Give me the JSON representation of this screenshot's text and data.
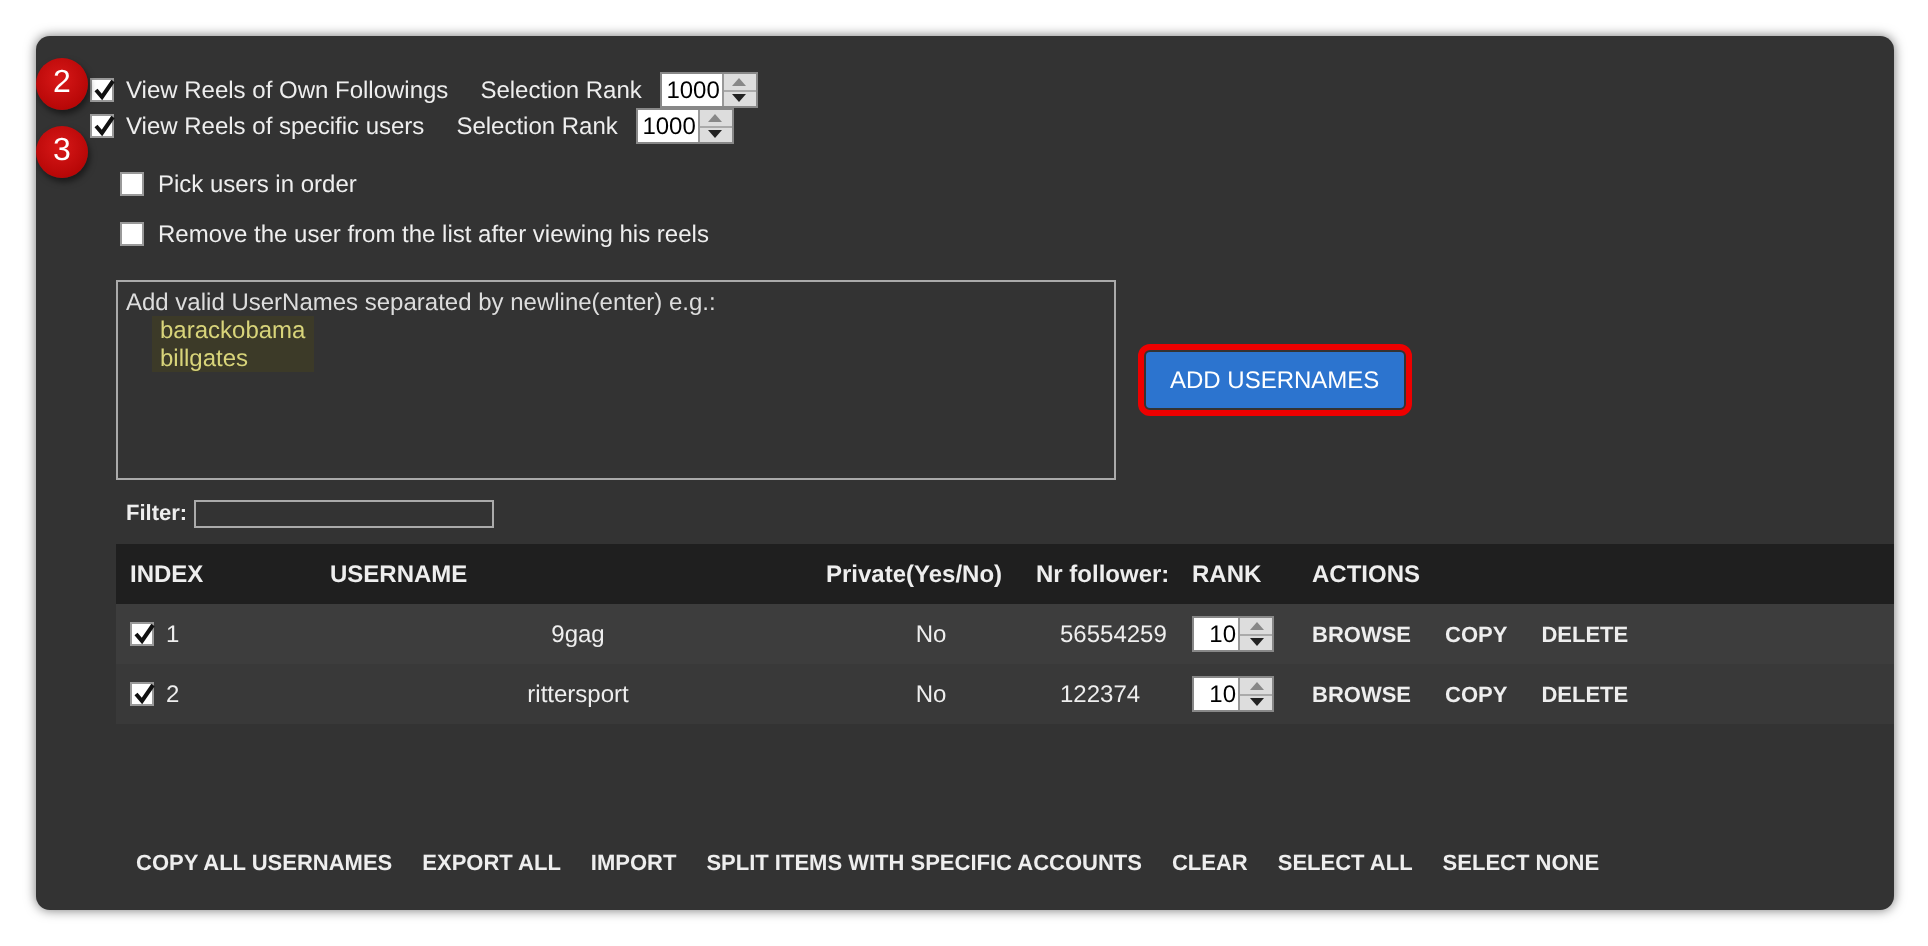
{
  "options": [
    {
      "step": "2",
      "label": "View Reels of Own Followings",
      "checked": true,
      "rank_label": "Selection Rank",
      "rank": "1000"
    },
    {
      "step": "3",
      "label": "View Reels of specific users",
      "checked": true,
      "rank_label": "Selection Rank",
      "rank": "1000"
    }
  ],
  "sub_options": [
    {
      "label": "Pick users in order",
      "checked": false
    },
    {
      "label": "Remove the user from the list after viewing his reels",
      "checked": false
    }
  ],
  "usernames_box": {
    "hint": "Add valid UserNames separated by newline(enter) e.g.:",
    "examples": [
      "barackobama",
      "billgates"
    ]
  },
  "add_button": {
    "label": "ADD USERNAMES",
    "highlighted": true
  },
  "filter": {
    "label": "Filter:"
  },
  "table": {
    "columns": [
      "INDEX",
      "USERNAME",
      "Private(Yes/No)",
      "Nr follower:",
      "RANK",
      "ACTIONS"
    ],
    "rows": [
      {
        "checked": true,
        "index": "1",
        "username": "9gag",
        "private": "No",
        "followers": "56554259",
        "rank": "10",
        "actions": [
          "BROWSE",
          "COPY",
          "DELETE"
        ]
      },
      {
        "checked": true,
        "index": "2",
        "username": "rittersport",
        "private": "No",
        "followers": "122374",
        "rank": "10",
        "actions": [
          "BROWSE",
          "COPY",
          "DELETE"
        ]
      }
    ]
  },
  "bottom_actions": [
    "COPY ALL USERNAMES",
    "EXPORT ALL",
    "IMPORT",
    "SPLIT ITEMS WITH SPECIFIC ACCOUNTS",
    "CLEAR",
    "SELECT ALL",
    "SELECT NONE"
  ]
}
